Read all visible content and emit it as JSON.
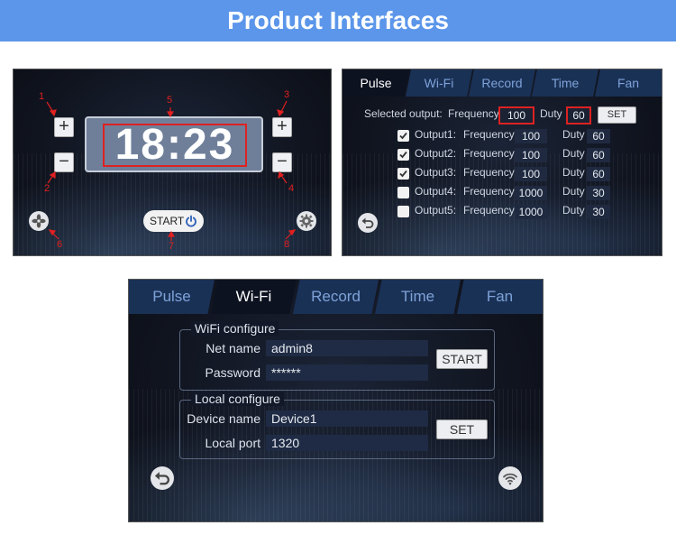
{
  "banner": {
    "title": "Product Interfaces"
  },
  "clock_screen": {
    "time": "18:23",
    "plus_left": "+",
    "minus_left": "−",
    "plus_right": "+",
    "minus_right": "−",
    "start_label": "START",
    "annotations": [
      "1",
      "2",
      "3",
      "4",
      "5",
      "6",
      "7",
      "8"
    ],
    "icons": {
      "fan": "fan-icon",
      "settings": "gear-icon",
      "power": "power-icon"
    }
  },
  "pulse_screen": {
    "tabs": [
      "Pulse",
      "Wi-Fi",
      "Record",
      "Time",
      "Fan"
    ],
    "active_tab": "Pulse",
    "selected_output_label": "Selected output:",
    "frequency_label": "Frequency",
    "duty_label": "Duty",
    "selected_frequency": "100",
    "selected_duty": "60",
    "set_label": "SET",
    "outputs": [
      {
        "name": "Output1:",
        "checked": true,
        "frequency": "100",
        "duty": "60"
      },
      {
        "name": "Output2:",
        "checked": true,
        "frequency": "100",
        "duty": "60"
      },
      {
        "name": "Output3:",
        "checked": true,
        "frequency": "100",
        "duty": "60"
      },
      {
        "name": "Output4:",
        "checked": false,
        "frequency": "1000",
        "duty": "30"
      },
      {
        "name": "Output5:",
        "checked": false,
        "frequency": "1000",
        "duty": "30"
      }
    ],
    "icons": {
      "back": "back-arrow-icon"
    }
  },
  "wifi_screen": {
    "tabs": [
      "Pulse",
      "Wi-Fi",
      "Record",
      "Time",
      "Fan"
    ],
    "active_tab": "Wi-Fi",
    "wifi_group": "WiFi configure",
    "net_name_label": "Net name",
    "net_name_value": "admin8",
    "password_label": "Password",
    "password_value": "******",
    "start_label": "START",
    "local_group": "Local configure",
    "device_name_label": "Device name",
    "device_name_value": "Device1",
    "local_port_label": "Local port",
    "local_port_value": "1320",
    "set_label": "SET",
    "icons": {
      "back": "back-arrow-icon",
      "wifi": "wifi-icon"
    }
  }
}
